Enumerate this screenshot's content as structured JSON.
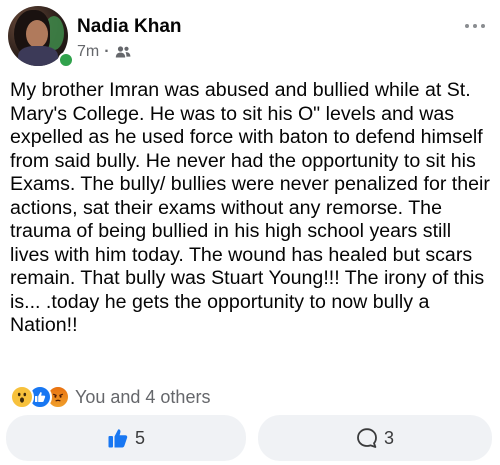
{
  "post": {
    "author": "Nadia Khan",
    "timestamp": "7m",
    "separator": "·",
    "audience_icon": "friends-icon",
    "online": true,
    "body": "My brother Imran was abused and bullied while at St. Mary's College. He was to sit his O\" levels and was expelled as he used force with baton to defend himself from said bully. He never had the opportunity to sit his Exams. The bully/ bullies were never penalized for their actions, sat their exams without any remorse. The trauma of being bullied in his high school years still lives with him today. The wound has healed but scars remain. That bully was Stuart Young!!! The irony of this is... .today he gets the opportunity to now bully a Nation!!"
  },
  "reactions": {
    "types": [
      "wow",
      "like",
      "angry"
    ],
    "summary": "You and 4 others"
  },
  "actions": {
    "like_count": "5",
    "comment_count": "3"
  },
  "colors": {
    "accent": "#1877f2",
    "online": "#31a24c",
    "secondary_text": "#65676b",
    "button_bg": "#f0f2f5"
  }
}
